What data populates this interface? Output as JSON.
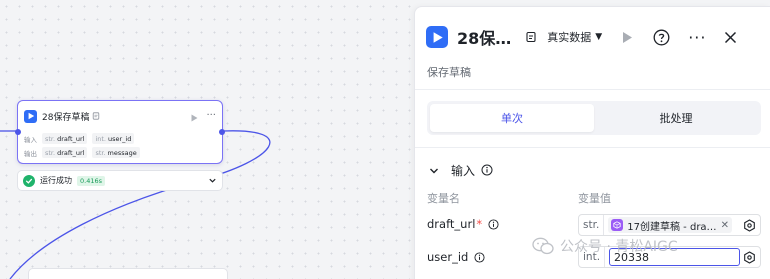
{
  "canvas": {
    "node": {
      "title": "28保存草稿",
      "input_label": "输入",
      "output_label": "输出",
      "inputs": [
        {
          "type": "str.",
          "name": "draft_url"
        },
        {
          "type": "int.",
          "name": "user_id"
        }
      ],
      "outputs": [
        {
          "type": "str.",
          "name": "draft_url"
        },
        {
          "type": "str.",
          "name": "message"
        }
      ]
    },
    "run_status": {
      "text": "运行成功",
      "duration": "0.416s"
    }
  },
  "panel": {
    "title": "28保…",
    "data_source": "真实数据",
    "subtitle": "保存草稿",
    "tabs": [
      {
        "label": "单次",
        "active": true
      },
      {
        "label": "批处理",
        "active": false
      }
    ],
    "input_section": {
      "title": "输入",
      "col_name": "变量名",
      "col_value": "变量值",
      "variables": [
        {
          "name": "draft_url",
          "required": true,
          "type": "str.",
          "ref": "17创建草稿 - dra…"
        },
        {
          "name": "user_id",
          "required": false,
          "type": "int.",
          "value": "20338"
        }
      ]
    }
  },
  "watermark": "公众号 · 青松AIGC",
  "colors": {
    "accent": "#4c55e8",
    "node_border": "#7b73f5",
    "success": "#1fb36b",
    "brand_icon": "#2f6df6"
  }
}
